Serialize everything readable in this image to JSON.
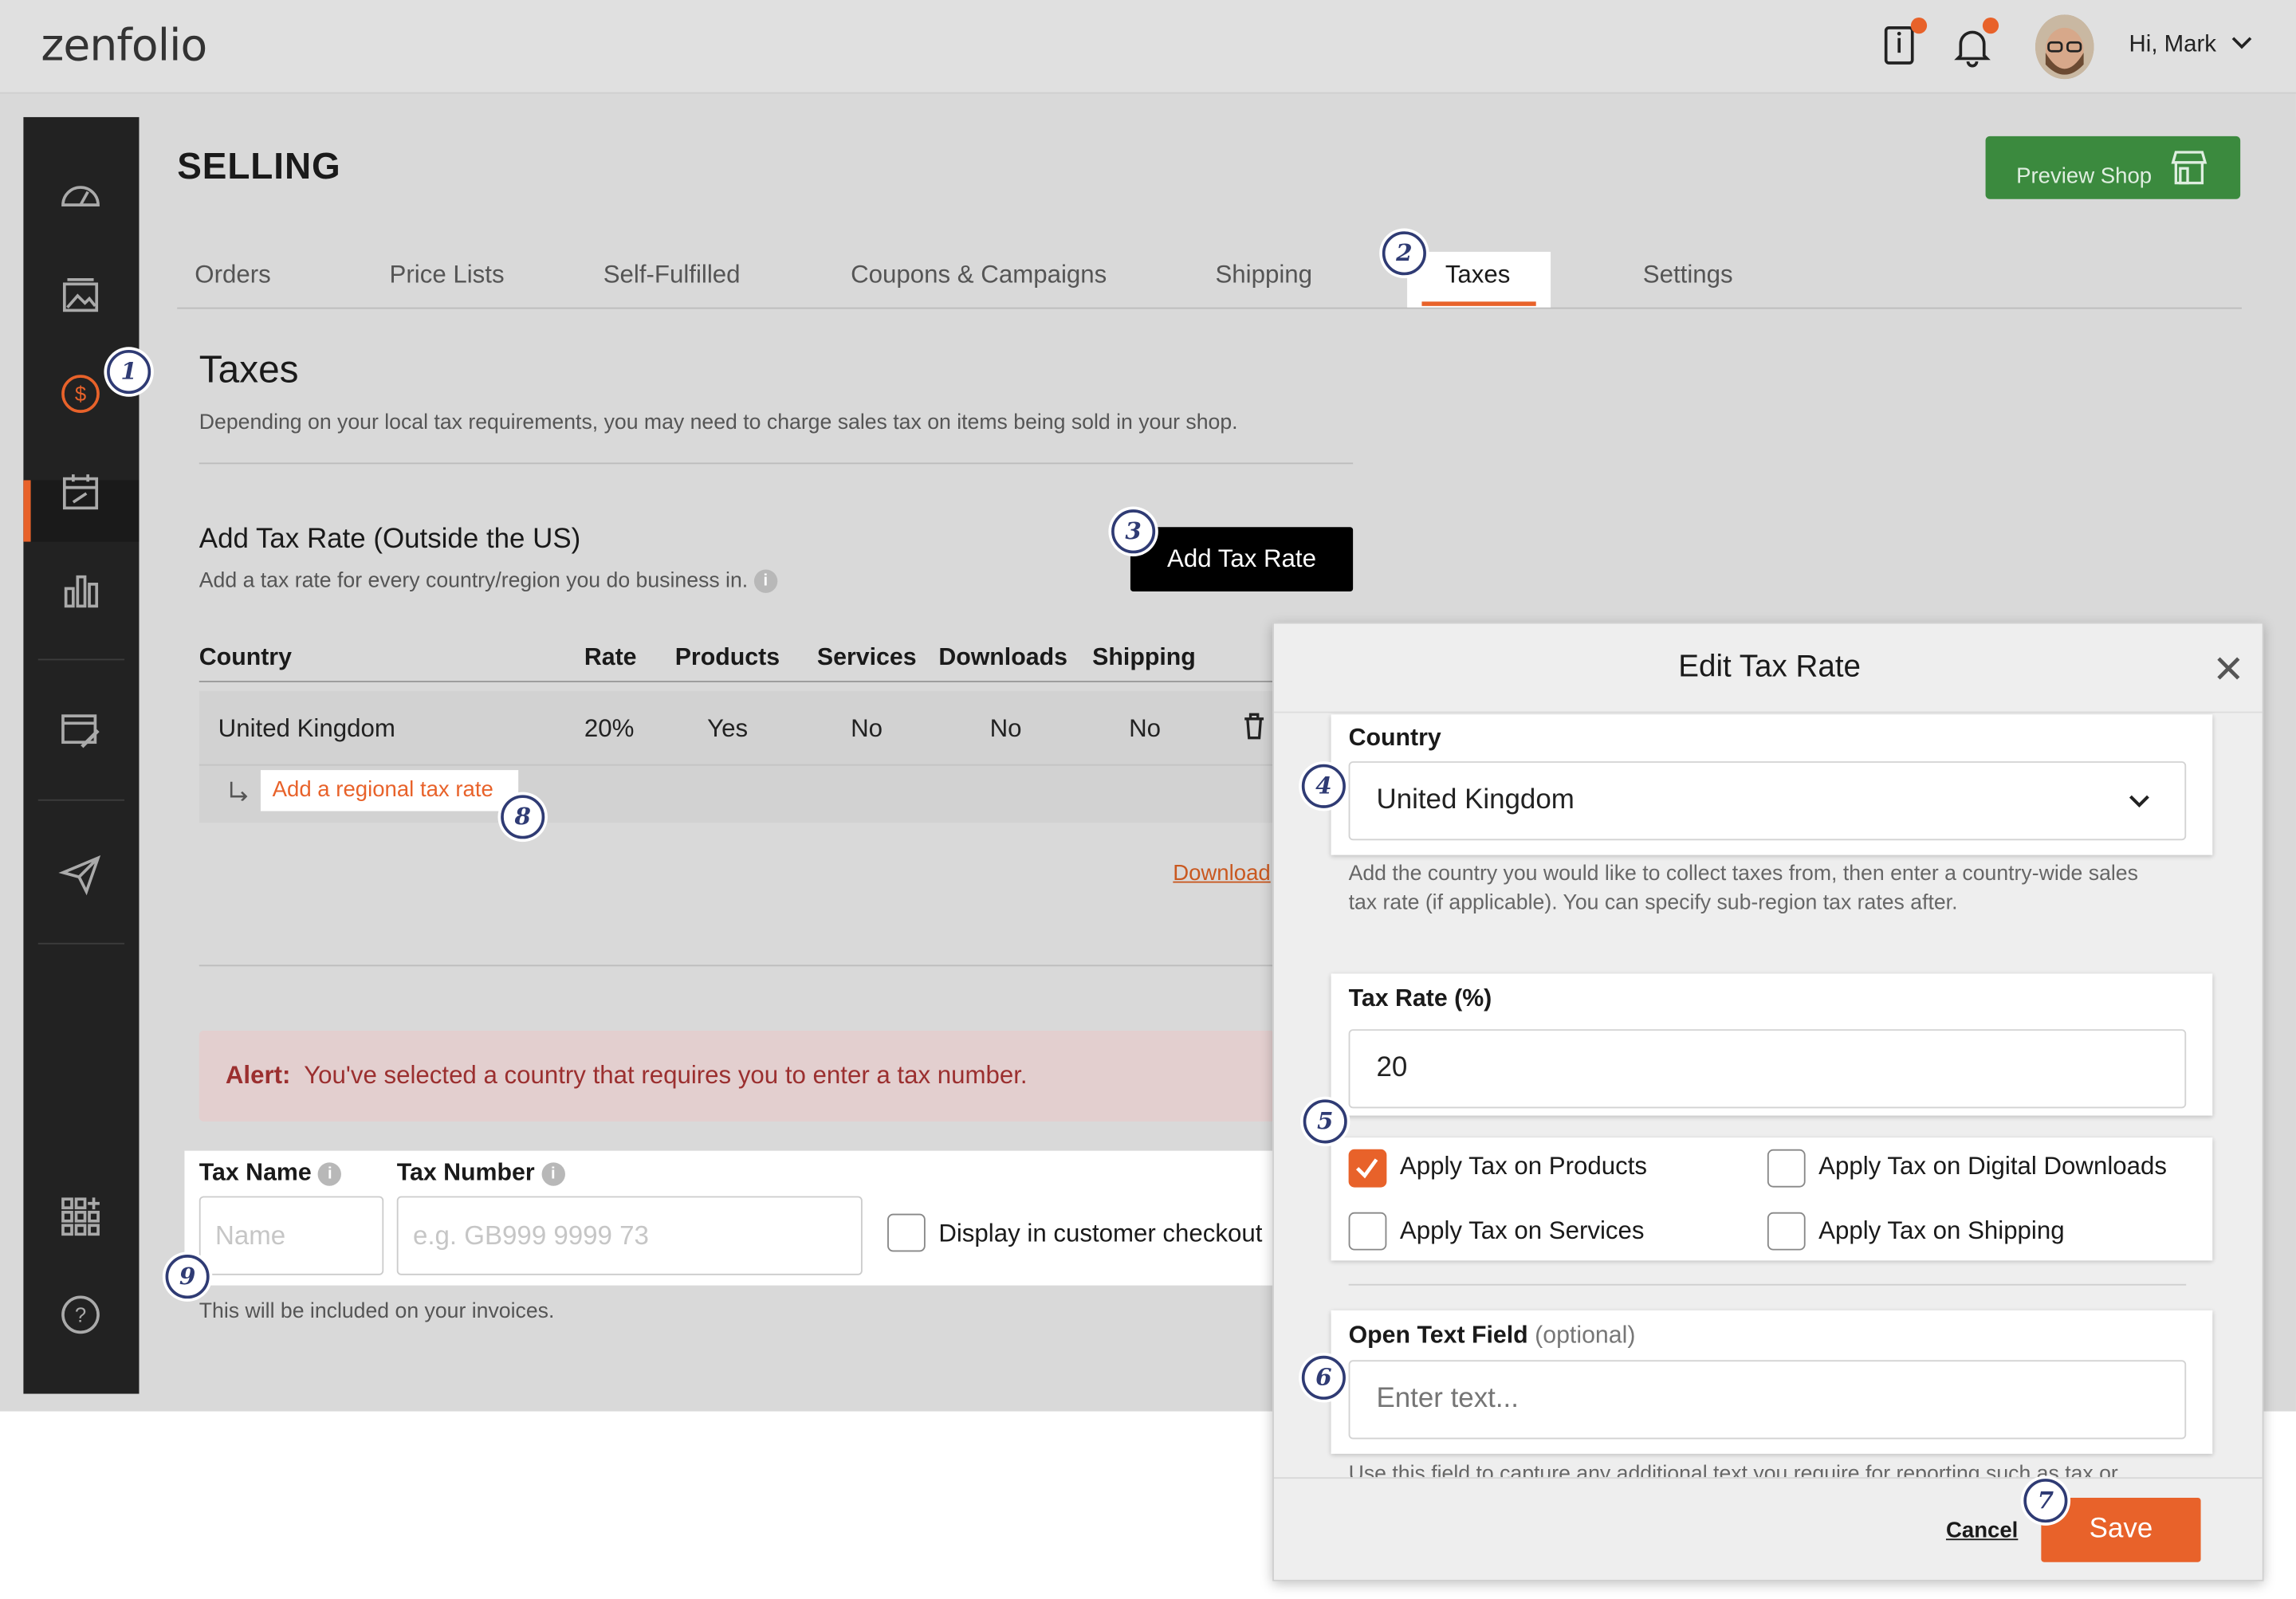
{
  "app": {
    "logo": "zenfolio"
  },
  "topbar": {
    "greeting": "Hi, Mark"
  },
  "header": {
    "title": "SELLING",
    "preview_button": "Preview Shop"
  },
  "tabs": [
    {
      "label": "Orders"
    },
    {
      "label": "Price Lists"
    },
    {
      "label": "Self-Fulfilled"
    },
    {
      "label": "Coupons & Campaigns"
    },
    {
      "label": "Shipping"
    },
    {
      "label": "Taxes",
      "active": true
    },
    {
      "label": "Settings"
    }
  ],
  "taxes": {
    "heading": "Taxes",
    "description": "Depending on your local tax requirements, you may need to charge sales tax on items being sold in your shop.",
    "add_heading": "Add Tax Rate (Outside the US)",
    "add_sub": "Add a tax rate for every country/region you do business in.",
    "add_button": "Add Tax Rate",
    "table": {
      "headers": [
        "Country",
        "Rate",
        "Products",
        "Services",
        "Downloads",
        "Shipping"
      ],
      "rows": [
        {
          "country": "United Kingdom",
          "rate": "20%",
          "products": "Yes",
          "services": "No",
          "downloads": "No",
          "shipping": "No"
        }
      ]
    },
    "regional_link": "Add a regional tax rate",
    "download_link": "Download",
    "alert_label": "Alert:",
    "alert_text": "You've selected a country that requires you to enter a tax number.",
    "tax_name_label": "Tax Name",
    "tax_number_label": "Tax Number",
    "tax_name_placeholder": "Name",
    "tax_number_placeholder": "e.g. GB999 9999 73",
    "display_checkout_label": "Display in customer checkout",
    "invoice_note": "This will be included on your invoices."
  },
  "modal": {
    "title": "Edit Tax Rate",
    "country_label": "Country",
    "country_value": "United Kingdom",
    "country_help": "Add the country you would like to collect taxes from, then enter a country-wide sales tax rate (if applicable). You can specify sub-region tax rates after.",
    "rate_label": "Tax Rate (%)",
    "rate_value": "20",
    "checkboxes": [
      {
        "label": "Apply Tax on Products",
        "checked": true
      },
      {
        "label": "Apply Tax on Digital Downloads",
        "checked": false
      },
      {
        "label": "Apply Tax on Services",
        "checked": false
      },
      {
        "label": "Apply Tax on Shipping",
        "checked": false
      }
    ],
    "open_text_label": "Open Text Field",
    "open_text_optional": "(optional)",
    "open_text_placeholder": "Enter text...",
    "open_text_help": "Use this field to capture any additional text you require for reporting such as tax or",
    "cancel": "Cancel",
    "save": "Save"
  },
  "badges": [
    "1",
    "2",
    "3",
    "4",
    "5",
    "6",
    "7",
    "8",
    "9"
  ],
  "colors": {
    "accent": "#e8622a",
    "sidebar": "#222222",
    "preview": "#3b8a3e",
    "badge": "#2f3b74"
  }
}
